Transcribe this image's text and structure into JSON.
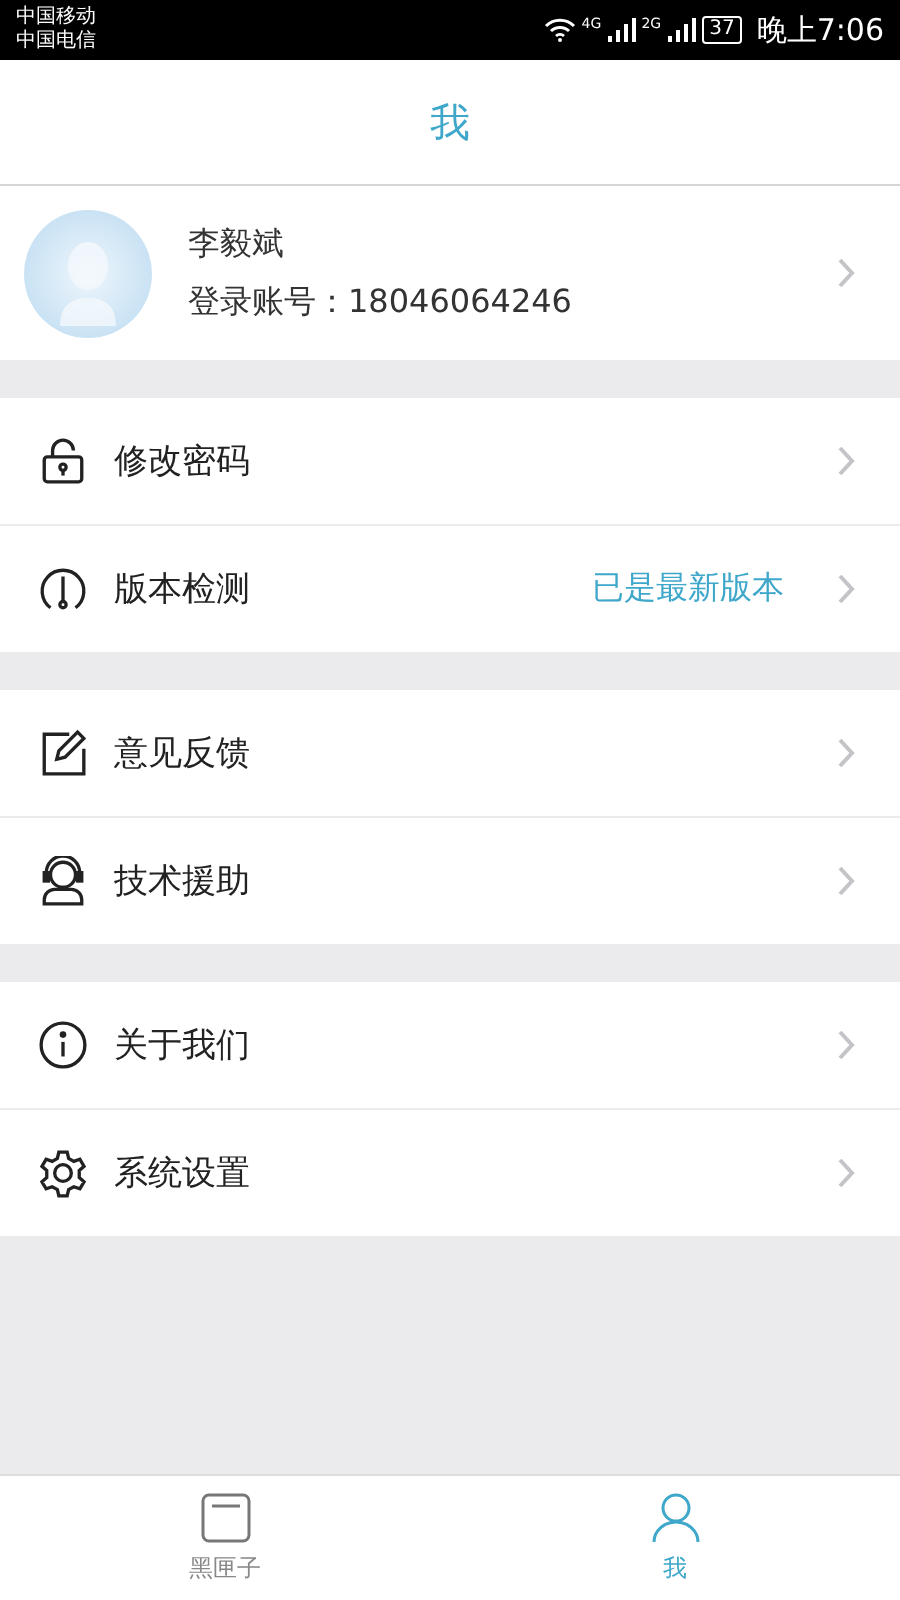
{
  "status_bar": {
    "carriers": [
      "中国移动",
      "中国电信"
    ],
    "network_labels": [
      "4G",
      "2G"
    ],
    "battery": "37",
    "time": "晚上7:06"
  },
  "header": {
    "title": "我"
  },
  "profile": {
    "name": "李毅斌",
    "account": "登录账号：18046064246"
  },
  "menu_groups": [
    [
      {
        "kind": "lock",
        "label": "修改密码"
      },
      {
        "kind": "meter",
        "label": "版本检测",
        "value": "已是最新版本"
      }
    ],
    [
      {
        "kind": "edit",
        "label": "意见反馈"
      },
      {
        "kind": "headset",
        "label": "技术援助"
      }
    ],
    [
      {
        "kind": "info",
        "label": "关于我们"
      },
      {
        "kind": "gear",
        "label": "系统设置"
      }
    ]
  ],
  "tabs": [
    {
      "kind": "box",
      "label": "黑匣子",
      "selected": false
    },
    {
      "kind": "person",
      "label": "我",
      "selected": true
    }
  ]
}
